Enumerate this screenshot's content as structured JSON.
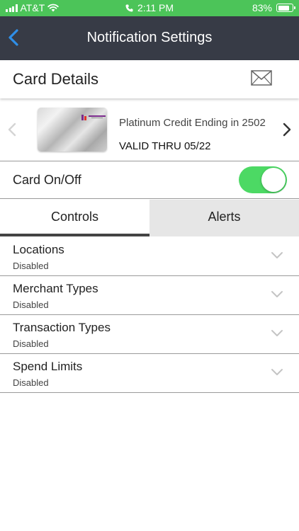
{
  "status_bar": {
    "carrier": "AT&T",
    "time": "2:11 PM",
    "battery": "83%",
    "battery_level": 0.83
  },
  "nav": {
    "title": "Notification Settings"
  },
  "card_details": {
    "title": "Card Details"
  },
  "card": {
    "description": "Platinum Credit Ending in 2502",
    "valid_thru": "VALID THRU 05/22"
  },
  "card_toggle": {
    "label": "Card On/Off",
    "on": true
  },
  "tabs": [
    {
      "label": "Controls",
      "active": true
    },
    {
      "label": "Alerts",
      "active": false
    }
  ],
  "controls": [
    {
      "title": "Locations",
      "status": "Disabled"
    },
    {
      "title": "Merchant Types",
      "status": "Disabled"
    },
    {
      "title": "Transaction Types",
      "status": "Disabled"
    },
    {
      "title": "Spend Limits",
      "status": "Disabled"
    }
  ],
  "colors": {
    "status_bar": "#4cc459",
    "nav_bar": "#373b46",
    "back_accent": "#2f8fe8",
    "toggle_on": "#4cd964"
  },
  "icons": {
    "back": "chevron-left-icon",
    "mail": "envelope-icon",
    "prev": "chevron-left-icon",
    "next": "chevron-right-icon",
    "expand": "chevron-down-icon"
  }
}
